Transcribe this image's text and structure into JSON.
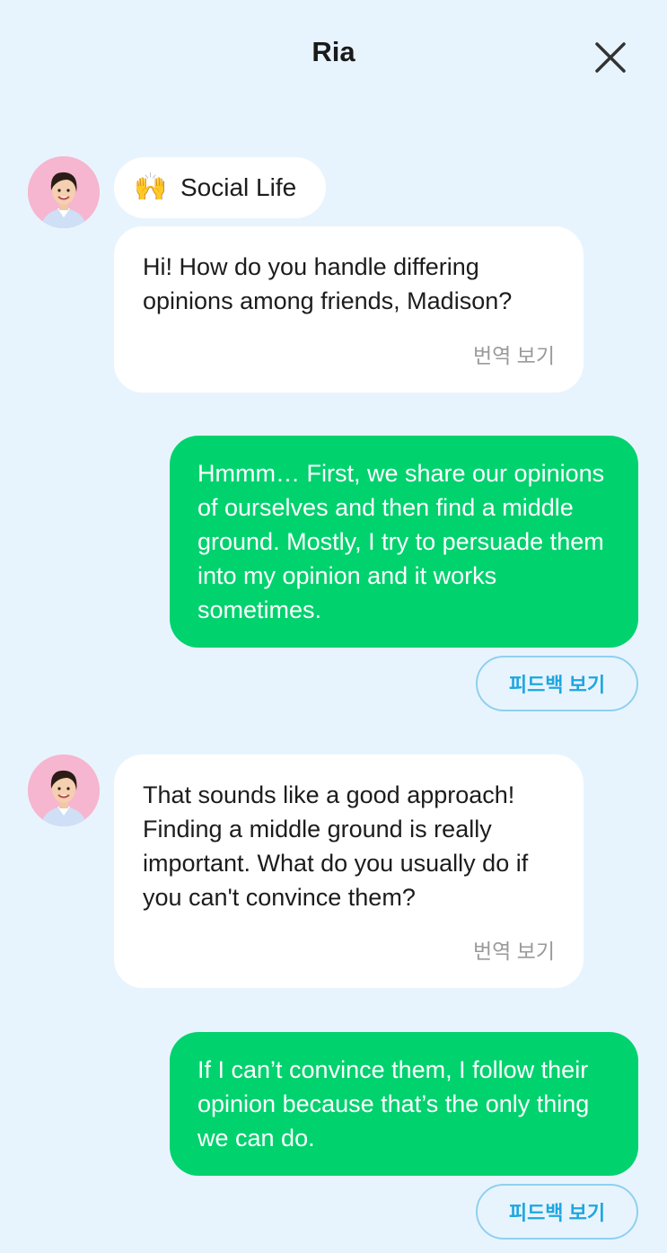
{
  "header": {
    "title": "Ria"
  },
  "topic": {
    "emoji": "🙌",
    "label": "Social Life"
  },
  "messages": [
    {
      "sender": "bot",
      "text": "Hi! How do you handle differing opinions among friends, Madison?",
      "translate_label": "번역 보기"
    },
    {
      "sender": "user",
      "text": "Hmmm… First, we share our opinions of ourselves and then find a middle ground. Mostly, I try to persuade them into my opinion and it works sometimes.",
      "feedback_label": "피드백 보기"
    },
    {
      "sender": "bot",
      "text": "That sounds like a good approach! Finding a middle ground is really important. What do you usually do if you can't convince them?",
      "translate_label": "번역 보기"
    },
    {
      "sender": "user",
      "text": "If I can’t convince them, I follow their opinion because that’s the only thing we can do.",
      "feedback_label": "피드백 보기"
    }
  ],
  "colors": {
    "background": "#e8f4fd",
    "user_bubble": "#00d26e",
    "bot_bubble": "#ffffff",
    "feedback_accent": "#1fa6e0",
    "avatar_background": "#f6b6cf"
  }
}
